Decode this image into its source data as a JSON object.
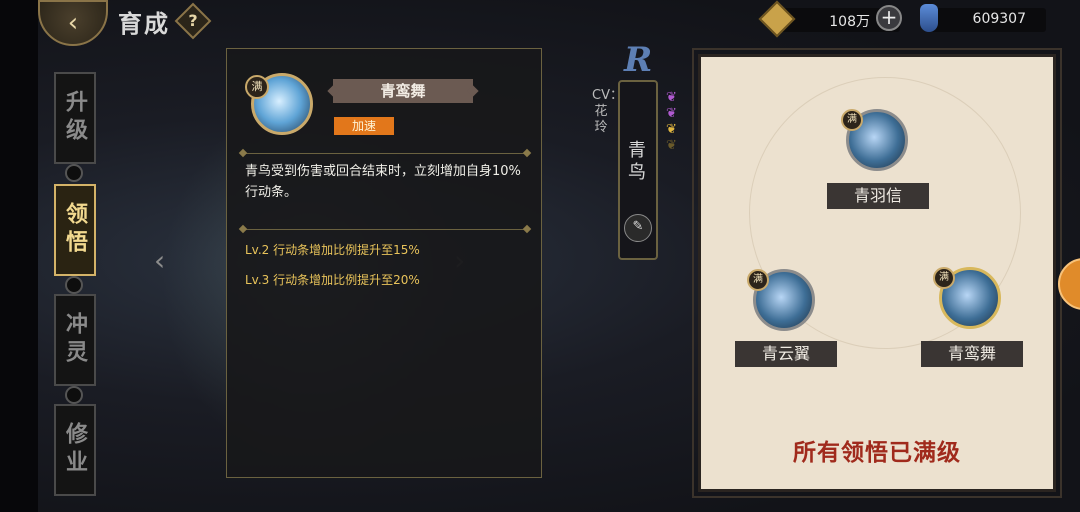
{
  "header": {
    "title": "育成",
    "help_label": "?",
    "back_icon": "back-arrow-icon"
  },
  "resources": {
    "coins": "108万",
    "plus_label": "+",
    "potion": "609307"
  },
  "tabs": [
    {
      "label": "升级",
      "active": false
    },
    {
      "label": "领悟",
      "active": true
    },
    {
      "label": "冲灵",
      "active": false
    },
    {
      "label": "修业",
      "active": false
    }
  ],
  "skill_detail": {
    "badge": "满",
    "name": "青鸾舞",
    "tag": "加速",
    "description": "青鸟受到伤害或回合结束时，立刻增加自身10%行动条。",
    "levels": [
      "Lv.2    行动条增加比例提升至15%",
      "Lv.3    行动条增加比例提升至20%"
    ]
  },
  "character": {
    "rarity": "R",
    "cv": "CV：花玲",
    "name": "青鸟",
    "nav_prev": "‹",
    "nav_next": "›"
  },
  "tree": {
    "nodes": [
      {
        "label": "青羽信",
        "badge": "满",
        "selected": false
      },
      {
        "label": "青云翼",
        "badge": "满",
        "selected": false
      },
      {
        "label": "青鸾舞",
        "badge": "满",
        "selected": true
      }
    ],
    "footer": "所有领悟已满级"
  },
  "colors": {
    "accent_gold": "#d4b368",
    "tag_orange": "#e2771b",
    "footer_red": "#a02a1c",
    "panel_bg": "#ece1cf"
  }
}
